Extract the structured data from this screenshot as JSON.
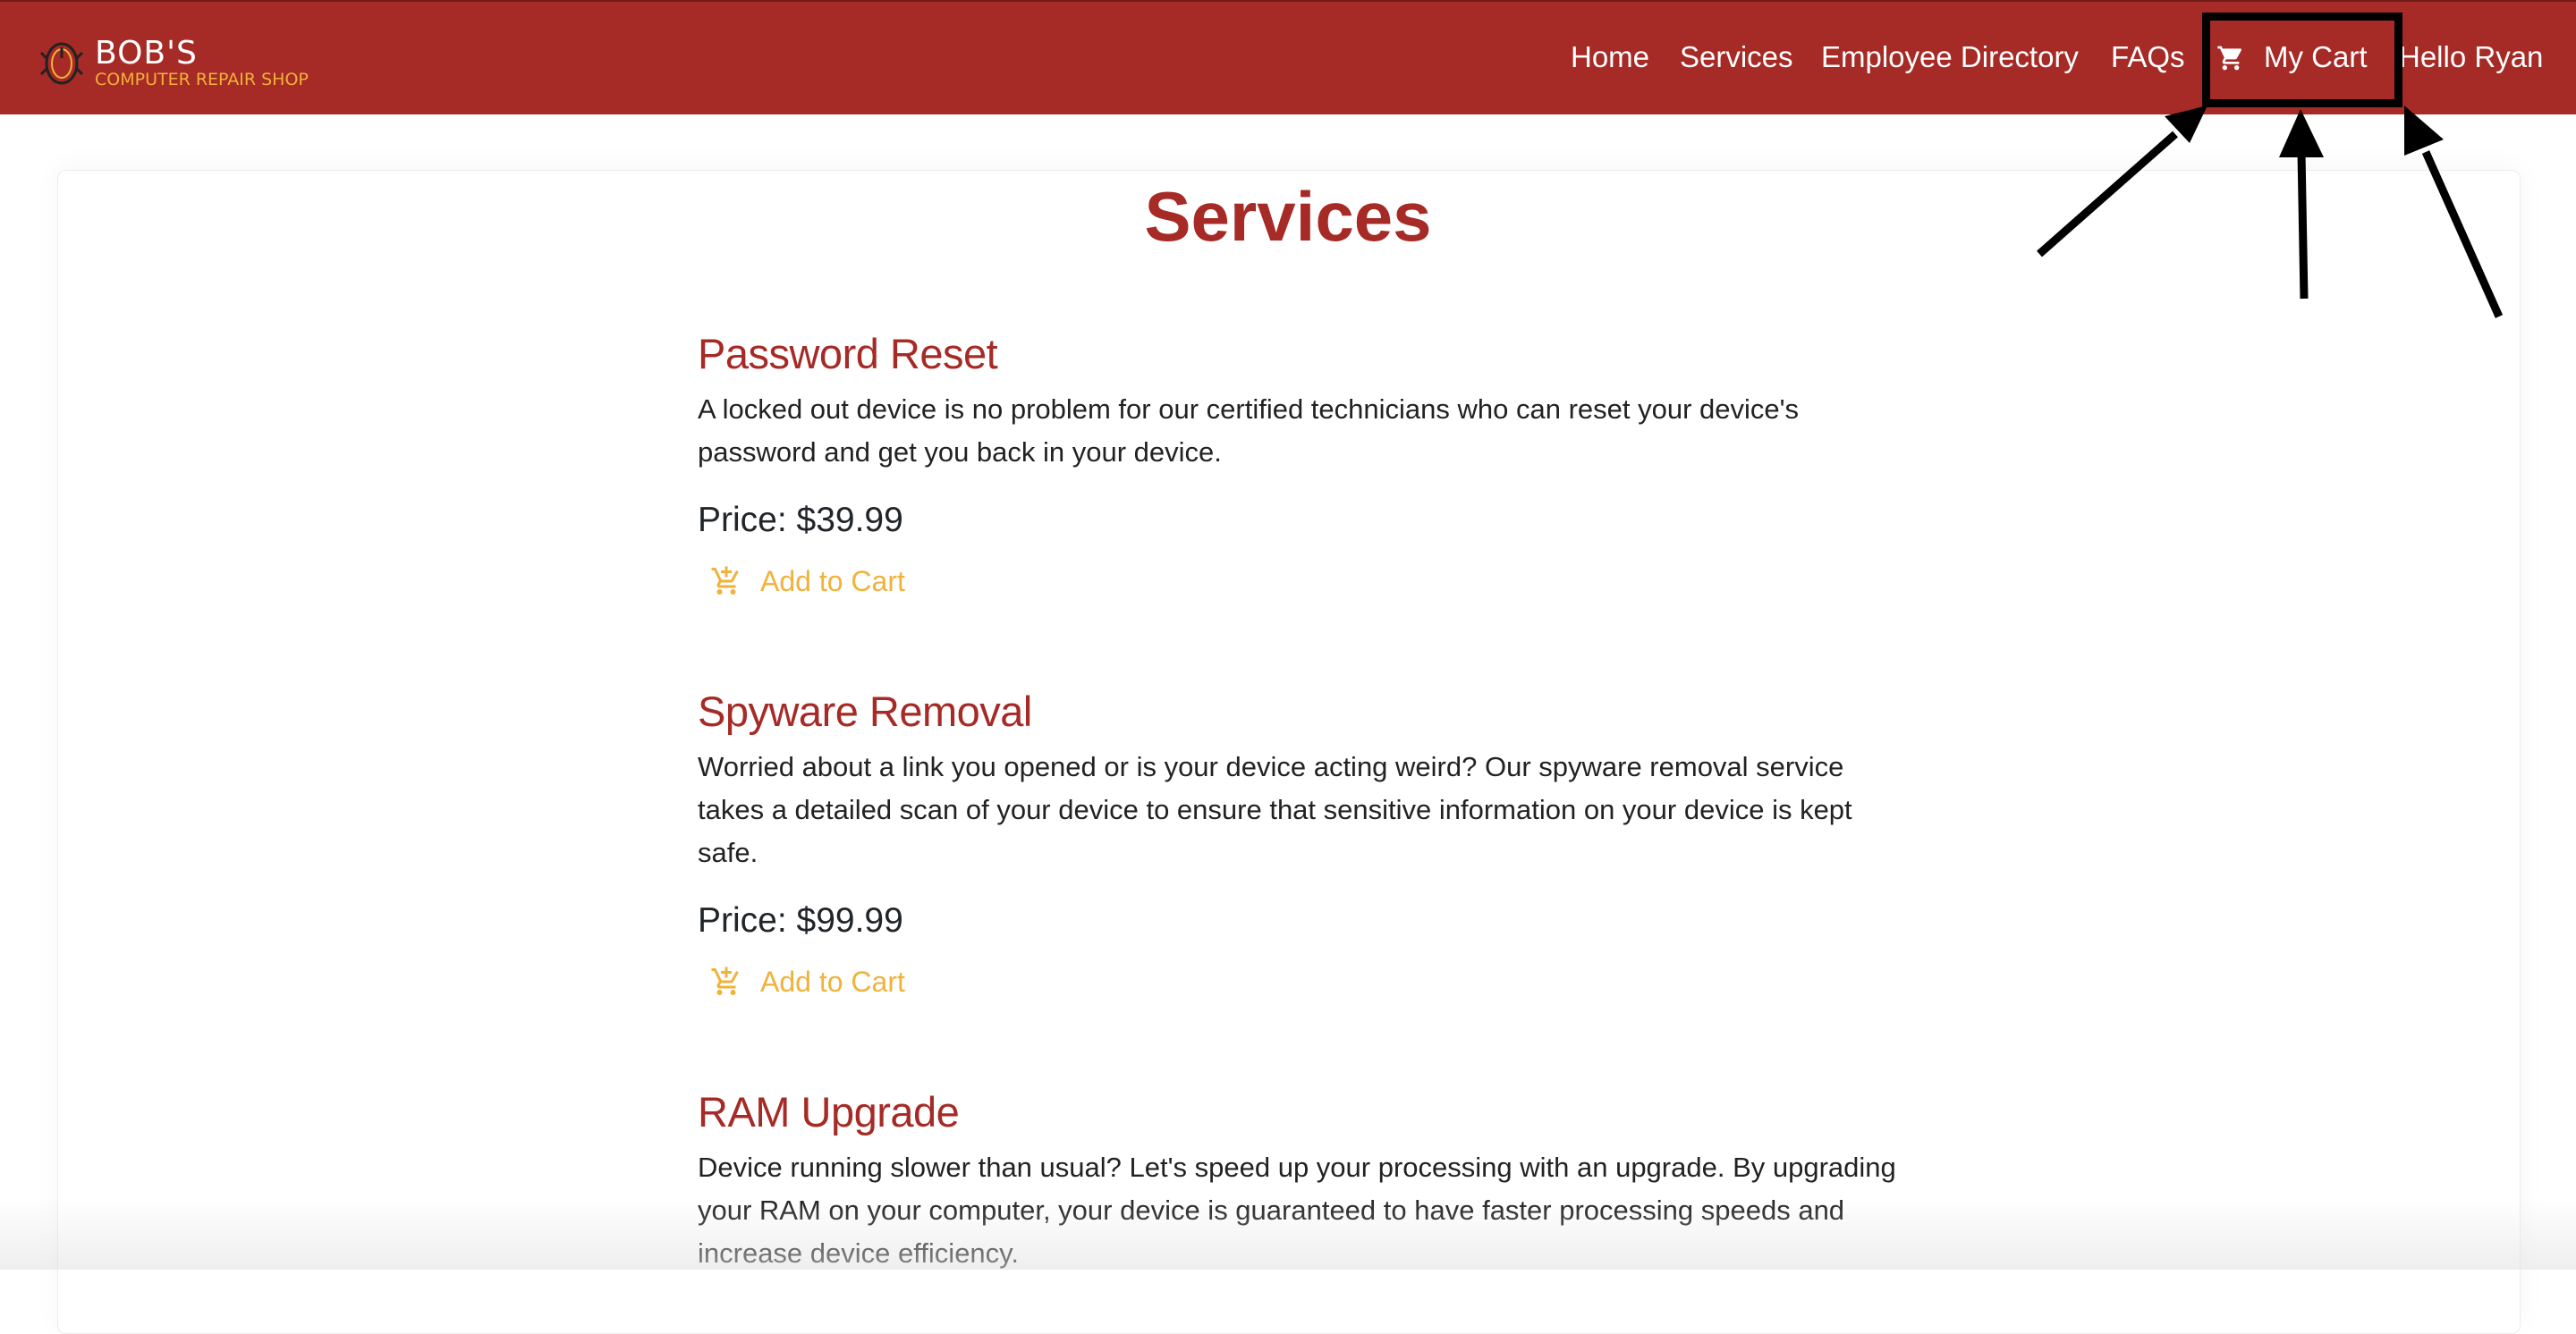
{
  "brand": {
    "name": "BOB'S",
    "subtitle": "COMPUTER REPAIR SHOP",
    "logo_icon": "mouse-logo-icon"
  },
  "nav": {
    "home": "Home",
    "services": "Services",
    "directory": "Employee Directory",
    "faqs": "FAQs",
    "cart": "My Cart",
    "cart_icon": "shopping-cart-icon",
    "greeting": "Hello Ryan"
  },
  "page": {
    "title": "Services"
  },
  "services": [
    {
      "title": "Password Reset",
      "description": "A locked out device is no problem for our certified technicians who can reset your device's password and get you back in your device.",
      "price": "Price: $39.99",
      "cta": "Add to Cart"
    },
    {
      "title": "Spyware Removal",
      "description": "Worried about a link you opened or is your device acting weird? Our spyware removal service takes a detailed scan of your device to ensure that sensitive information on your device is kept safe.",
      "price": "Price: $99.99",
      "cta": "Add to Cart"
    },
    {
      "title": "RAM Upgrade",
      "description": "Device running slower than usual? Let's speed up your processing with an upgrade. By upgrading your RAM on your computer, your device is guaranteed to have faster processing speeds and increase device efficiency."
    }
  ],
  "colors": {
    "navbar": "#a62a26",
    "heading": "#a62a26",
    "accent": "#f0b23a",
    "annotation": "#000000"
  }
}
